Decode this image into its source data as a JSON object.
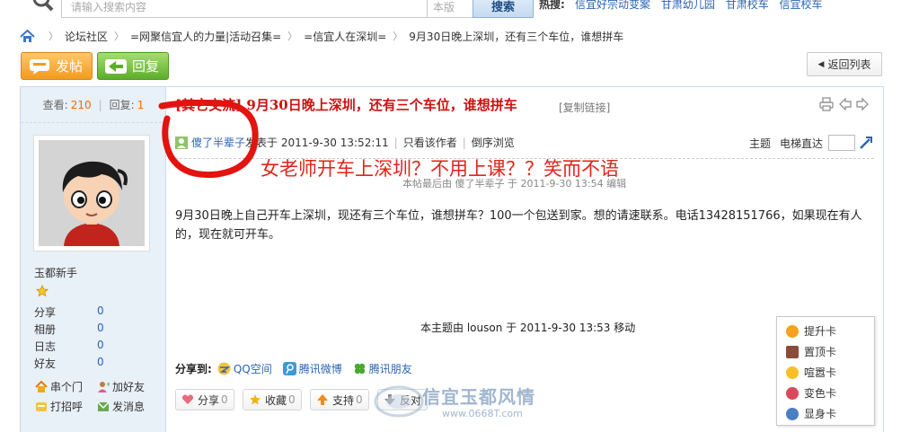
{
  "search": {
    "placeholder": "请输入搜索内容",
    "scope": "本版",
    "button": "搜索",
    "hot_label": "热搜:",
    "hot_links": [
      "信宜好宗动变案",
      "甘肃幼儿园",
      "甘肃校车",
      "信宜校车"
    ]
  },
  "breadcrumb": [
    "论坛社区",
    "=网聚信宜人的力量|活动召集=",
    "=信宜人在深圳=",
    "9月30日晚上深圳，还有三个车位，谁想拼车"
  ],
  "toolbar": {
    "new_post": "发帖",
    "reply": "回复",
    "back_to_list": "返回列表"
  },
  "stats": {
    "views_label": "查看:",
    "views": "210",
    "replies_label": "回复:",
    "replies": "1"
  },
  "post": {
    "title": "[其它交流] 9月30日晚上深圳，还有三个车位，谁想拼车",
    "copy_link": "[复制链接]",
    "author": "傻了半辈子",
    "posted_at": "发表于 2011-9-30 13:52:11",
    "only_author": "只看该作者",
    "reverse": "倒序浏览",
    "topic_label": "主题",
    "floor_jump": "电梯直达",
    "annotation": "女老师开车上深圳？不用上课？？笑而不语",
    "last_edit": "本帖最后由 傻了半辈子 于 2011-9-30 13:54 编辑",
    "body": "9月30日晚上自己开车上深圳，现还有三个车位，谁想拼车？100一个包送到家。想的请速联系。电话13428151766，如果现在有人的，现在就可开车。",
    "moved_note": "本主题由 louson 于 2011-9-30 13:53 移动"
  },
  "profile": {
    "rank": "玉都新手",
    "rows": [
      {
        "label": "分享",
        "value": "0"
      },
      {
        "label": "相册",
        "value": "0"
      },
      {
        "label": "日志",
        "value": "0"
      },
      {
        "label": "好友",
        "value": "0"
      }
    ],
    "links": [
      "串个门",
      "加好友",
      "打招呼",
      "发消息"
    ]
  },
  "share": {
    "label": "分享到:",
    "items": [
      "QQ空间",
      "腾讯微博",
      "腾讯朋友"
    ]
  },
  "actions": {
    "share": "分享",
    "share_count": "0",
    "favorite": "收藏",
    "favorite_count": "0",
    "support": "支持",
    "support_count": "0",
    "oppose": "反对"
  },
  "cards": [
    "提升卡",
    "置顶卡",
    "喧嚣卡",
    "变色卡",
    "显身卡"
  ],
  "watermark": {
    "text": "信宜玉都风情",
    "url": "www.0668T.com"
  },
  "colors": {
    "accent_red": "#c11111",
    "link_blue": "#2b65b3",
    "orange": "#f26c00",
    "annotation_red": "#e0241b"
  }
}
